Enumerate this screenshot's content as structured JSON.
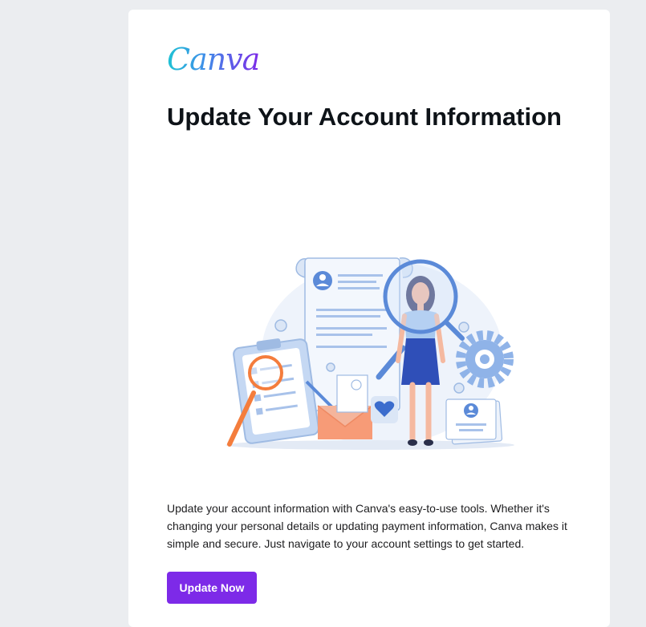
{
  "email": {
    "logo_text": "Canva",
    "title": "Update Your Account Information",
    "body": "Update your account information with Canva's easy-to-use tools. Whether it's changing your personal details or updating payment information, Canva makes it simple and secure. Just navigate to your account settings to get started.",
    "cta_label": "Update Now"
  },
  "colors": {
    "page_background": "#ebedf0",
    "card_background": "#ffffff",
    "brand_purple": "#7d2ae8",
    "brand_teal": "#1fc3d4",
    "text_dark": "#0e1318"
  },
  "illustration": {
    "icon_names": [
      "document-icon",
      "clipboard-icon",
      "magnifier-icon",
      "gear-icon",
      "envelope-icon",
      "heart-icon",
      "user-icon",
      "pen-icon"
    ]
  }
}
